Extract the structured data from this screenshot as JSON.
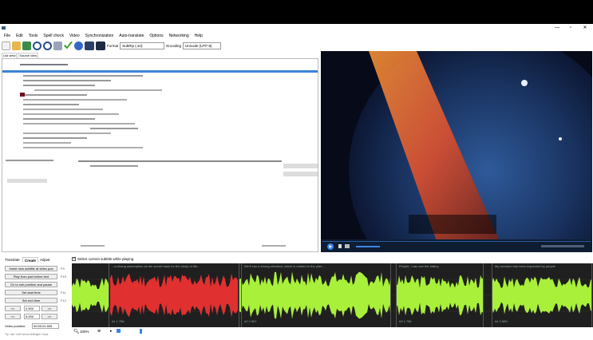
{
  "menu": [
    "File",
    "Edit",
    "Tools",
    "Spell check",
    "Video",
    "Synchronization",
    "Auto-translate",
    "Options",
    "Networking",
    "Help"
  ],
  "window_controls": {
    "minimize": "—",
    "maximize": "▫",
    "close": "✕"
  },
  "toolbar": {
    "format_label": "Format",
    "format_value": "SubRip (.srt)",
    "encoding_label": "Encoding",
    "encoding_value": "Unicode (UTF-8)"
  },
  "view_tabs": [
    "List view",
    "Source view"
  ],
  "bottom_tabs": [
    "Translate",
    "Create",
    "Adjust"
  ],
  "select_current_label": "Select current subtitle while playing",
  "create_buttons": [
    {
      "label": "Insert new subtitle at video pos",
      "hotkey": "F9"
    },
    {
      "label": "Play from just before text",
      "hotkey": "F10"
    },
    {
      "label": "Go to sub position and pause",
      "hotkey": ""
    },
    {
      "label": "Set start time",
      "hotkey": "F11"
    },
    {
      "label": "Set end time",
      "hotkey": "F12"
    }
  ],
  "seek": {
    "back": "<<",
    "forward": ">>",
    "step1": "0.500",
    "step2": "5.000"
  },
  "video_position": {
    "label": "Video position:",
    "value": "00:00:01.505"
  },
  "tip": "Tip: use <ctrl+arrow left/right> keys",
  "zoom": "100%",
  "waveform_segments": [
    {
      "text": "...a strong assumption as the secret base for the study of life...",
      "footer": "#1  1.756"
    },
    {
      "text": "We'll can a strong elevated, which is related to the plan...",
      "footer": "#2  2.967"
    },
    {
      "text": "People, I can see the lottery.",
      "footer": "#3  1.756"
    },
    {
      "text": "My scenario has been inspected by people",
      "footer": "#4  2.569"
    }
  ],
  "colors": {
    "selected_row": "#3d84d6",
    "wave_green": "#a8f03a",
    "wave_red": "#e03030",
    "wave_bg": "#1f1f1f"
  }
}
